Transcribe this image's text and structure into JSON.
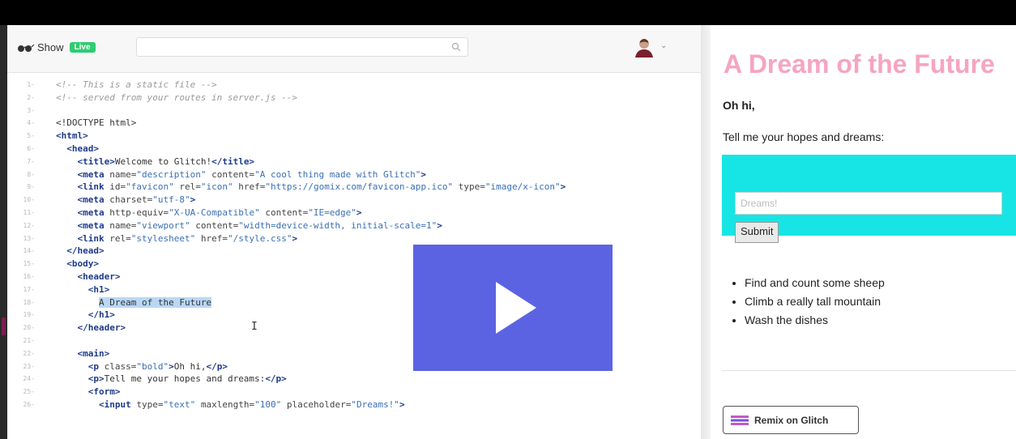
{
  "editor": {
    "app_label": "Show",
    "live_badge": "Live",
    "search": {
      "placeholder": ""
    },
    "code_lines": [
      {
        "n": "1",
        "html": "<span class=\"cm\">&lt;!-- This is a static file --&gt;</span>"
      },
      {
        "n": "2",
        "html": "<span class=\"cm\">&lt;!-- served from your routes in server.js --&gt;</span>"
      },
      {
        "n": "3",
        "html": ""
      },
      {
        "n": "4",
        "html": "&lt;!DOCTYPE html&gt;"
      },
      {
        "n": "5",
        "html": "<span class=\"tg\">&lt;html&gt;</span>"
      },
      {
        "n": "6",
        "html": "  <span class=\"tg\">&lt;head&gt;</span>"
      },
      {
        "n": "7",
        "html": "    <span class=\"tg\">&lt;title&gt;</span>Welcome to Glitch!<span class=\"tg\">&lt;/title&gt;</span>"
      },
      {
        "n": "8",
        "html": "    <span class=\"tg\">&lt;meta</span> <span class=\"at\">name=</span><span class=\"st\">\"description\"</span> <span class=\"at\">content=</span><span class=\"st\">\"A cool thing made with Glitch\"</span><span class=\"tg\">&gt;</span>"
      },
      {
        "n": "9",
        "html": "    <span class=\"tg\">&lt;link</span> <span class=\"at\">id=</span><span class=\"st\">\"favicon\"</span> <span class=\"at\">rel=</span><span class=\"st\">\"icon\"</span> <span class=\"at\">href=</span><span class=\"st\">\"https://gomix.com/favicon-app.ico\"</span> <span class=\"at\">type=</span><span class=\"st\">\"image/x-icon\"</span><span class=\"tg\">&gt;</span>"
      },
      {
        "n": "10",
        "html": "    <span class=\"tg\">&lt;meta</span> <span class=\"at\">charset=</span><span class=\"st\">\"utf-8\"</span><span class=\"tg\">&gt;</span>"
      },
      {
        "n": "11",
        "html": "    <span class=\"tg\">&lt;meta</span> <span class=\"at\">http-equiv=</span><span class=\"st\">\"X-UA-Compatible\"</span> <span class=\"at\">content=</span><span class=\"st\">\"IE=edge\"</span><span class=\"tg\">&gt;</span>"
      },
      {
        "n": "12",
        "html": "    <span class=\"tg\">&lt;meta</span> <span class=\"at\">name=</span><span class=\"st\">\"viewport\"</span> <span class=\"at\">content=</span><span class=\"st\">\"width=device-width, initial-scale=1\"</span><span class=\"tg\">&gt;</span>"
      },
      {
        "n": "13",
        "html": "    <span class=\"tg\">&lt;link</span> <span class=\"at\">rel=</span><span class=\"st\">\"stylesheet\"</span> <span class=\"at\">href=</span><span class=\"st\">\"/style.css\"</span><span class=\"tg\">&gt;</span>"
      },
      {
        "n": "14",
        "html": "  <span class=\"tg\">&lt;/head&gt;</span>"
      },
      {
        "n": "15",
        "html": "  <span class=\"tg\">&lt;body&gt;</span>"
      },
      {
        "n": "16",
        "html": "    <span class=\"tg\">&lt;header&gt;</span>"
      },
      {
        "n": "17",
        "html": "      <span class=\"tg\">&lt;h1&gt;</span>"
      },
      {
        "n": "18",
        "html": "        <span class=\"sel\">A Dream of the Future</span>"
      },
      {
        "n": "19",
        "html": "      <span class=\"tg\">&lt;/h1&gt;</span>"
      },
      {
        "n": "20",
        "html": "    <span class=\"tg\">&lt;/header&gt;</span>"
      },
      {
        "n": "21",
        "html": ""
      },
      {
        "n": "22",
        "html": "    <span class=\"tg\">&lt;main&gt;</span>"
      },
      {
        "n": "23",
        "html": "      <span class=\"tg\">&lt;p</span> <span class=\"at\">class=</span><span class=\"st\">\"bold\"</span><span class=\"tg\">&gt;</span>Oh hi,<span class=\"tg\">&lt;/p&gt;</span>"
      },
      {
        "n": "24",
        "html": "      <span class=\"tg\">&lt;p&gt;</span>Tell me your hopes and dreams:<span class=\"tg\">&lt;/p&gt;</span>"
      },
      {
        "n": "25",
        "html": "      <span class=\"tg\">&lt;form&gt;</span>"
      },
      {
        "n": "26",
        "html": "        <span class=\"tg\">&lt;input</span> <span class=\"at\">type=</span><span class=\"st\">\"text\"</span> <span class=\"at\">maxlength=</span><span class=\"st\">\"100\"</span> <span class=\"at\">placeholder=</span><span class=\"st\">\"Dreams!\"</span><span class=\"tg\">&gt;</span>"
      }
    ]
  },
  "preview": {
    "title": "A Dream of the Future",
    "greeting": "Oh hi,",
    "prompt": "Tell me your hopes and dreams:",
    "input_placeholder": "Dreams!",
    "submit_label": "Submit",
    "dreams": [
      "Find and count some sheep",
      "Climb a really tall mountain",
      "Wash the dishes"
    ],
    "remix_label": "Remix on Glitch"
  },
  "overlay": {
    "icon": "play-icon"
  },
  "colors": {
    "title_pink": "#f6a4c2",
    "form_cyan": "#17e5e5",
    "overlay_blue": "#5b63e3",
    "live_green": "#2ecc71"
  }
}
